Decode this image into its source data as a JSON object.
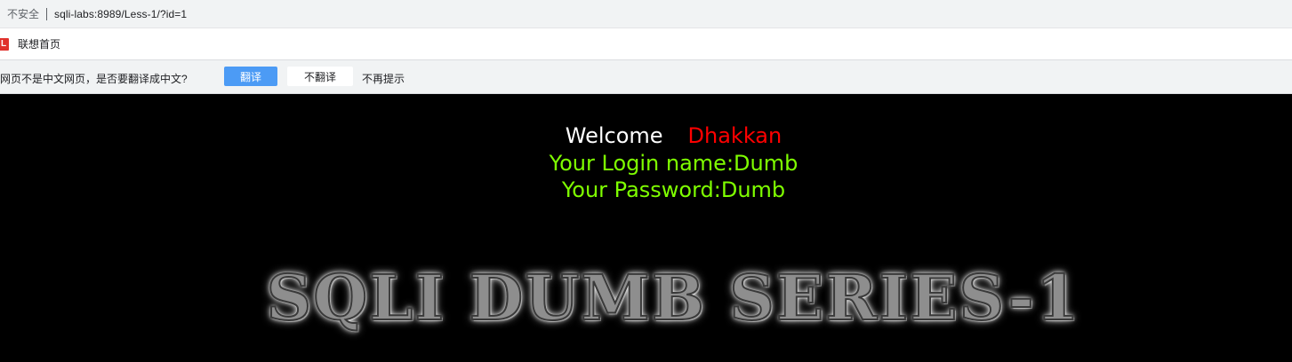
{
  "browser": {
    "security_label": "不安全",
    "url": "sqli-labs:8989/Less-1/?id=1",
    "bookmark": {
      "icon": "L",
      "label": "联想首页"
    },
    "translate_bar": {
      "message": "该网页不是中文网页，是否要翻译成中文?",
      "translate_button": "翻译",
      "no_translate_button": "不翻译",
      "never_ask": "不再提示"
    }
  },
  "page": {
    "welcome": "Welcome",
    "username_display": "Dhakkan",
    "login_name": "Your Login name:Dumb",
    "password": "Your Password:Dumb",
    "banner": "SQLI DUMB SERIES-1"
  },
  "colors": {
    "background": "#000000",
    "welcome": "#ffffff",
    "username": "#ff0000",
    "result": "#7fff00",
    "translate_button": "#4c9bf5"
  }
}
